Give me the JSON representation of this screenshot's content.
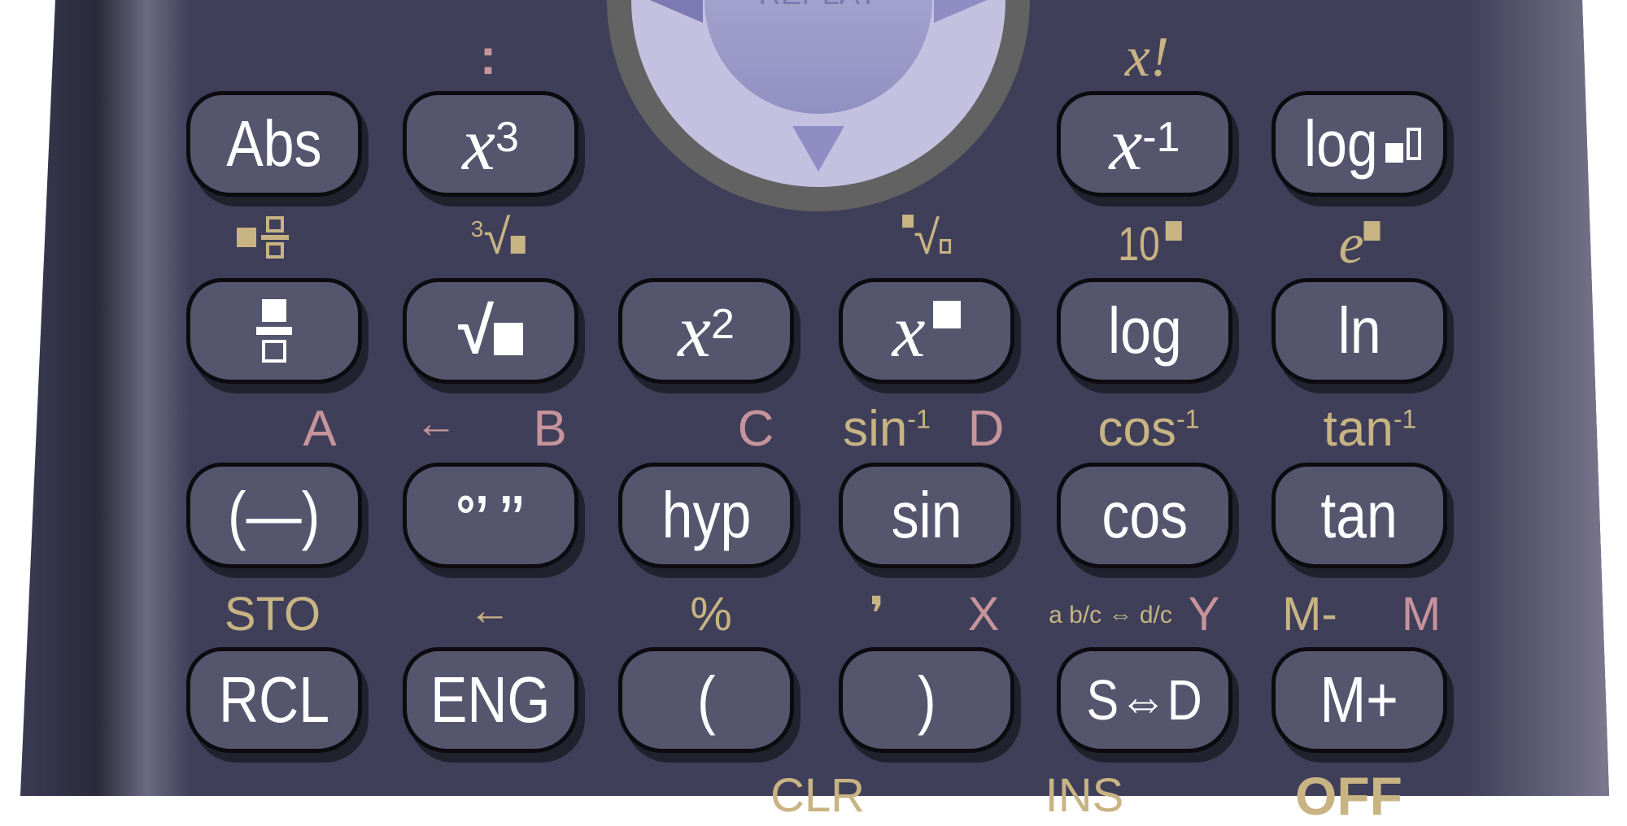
{
  "dial": {
    "replay_label": "REPLAY"
  },
  "colors": {
    "body": "#3f3f5a",
    "key": "#55566e",
    "shift": "#c8b483",
    "alpha": "#c8949c",
    "dial": "#c4c0e0"
  },
  "keys": [
    {
      "id": "abs",
      "label": "Abs"
    },
    {
      "id": "x-cubed",
      "base": "x",
      "sup": "3"
    },
    {
      "id": "x-inverse",
      "base": "x",
      "sup": "-1"
    },
    {
      "id": "log-base",
      "label": "log"
    },
    {
      "id": "fraction",
      "icon": "fraction-icon"
    },
    {
      "id": "sqrt",
      "label": "√"
    },
    {
      "id": "x-squared",
      "base": "x",
      "sup": "2"
    },
    {
      "id": "x-power",
      "base": "x"
    },
    {
      "id": "log",
      "label": "log"
    },
    {
      "id": "ln",
      "label": "ln"
    },
    {
      "id": "negative",
      "label": "(—)"
    },
    {
      "id": "degrees",
      "label": "°’ ’’"
    },
    {
      "id": "hyp",
      "label": "hyp"
    },
    {
      "id": "sin",
      "label": "sin"
    },
    {
      "id": "cos",
      "label": "cos"
    },
    {
      "id": "tan",
      "label": "tan"
    },
    {
      "id": "rcl",
      "label": "RCL"
    },
    {
      "id": "eng",
      "label": "ENG"
    },
    {
      "id": "open-paren",
      "label": "("
    },
    {
      "id": "close-paren",
      "label": ")"
    },
    {
      "id": "s-to-d",
      "label": "S⇔D"
    },
    {
      "id": "m-plus",
      "label": "M+"
    }
  ],
  "shift_labels": {
    "colon": ":",
    "factorial_x": "x",
    "factorial_bang": "!",
    "cube_root_index": "3",
    "cube_root_sign": "√",
    "x_root_sign": "√",
    "ten_power": "10",
    "e_power": "e",
    "A": "A",
    "left_arrow_pink": "←",
    "B": "B",
    "C": "C",
    "sin_inv": "sin",
    "D": "D",
    "cos_inv": "cos",
    "tan_inv": "tan",
    "inv_sup": "-1",
    "sto": "STO",
    "left_arrow_gold": "←",
    "percent": "%",
    "comma": "❜",
    "X": "X",
    "mixed_frac": "a b/c ⇔ d/c",
    "Y": "Y",
    "m_minus": "M-",
    "M": "M",
    "clr": "CLR",
    "ins": "INS",
    "off": "OFF"
  }
}
